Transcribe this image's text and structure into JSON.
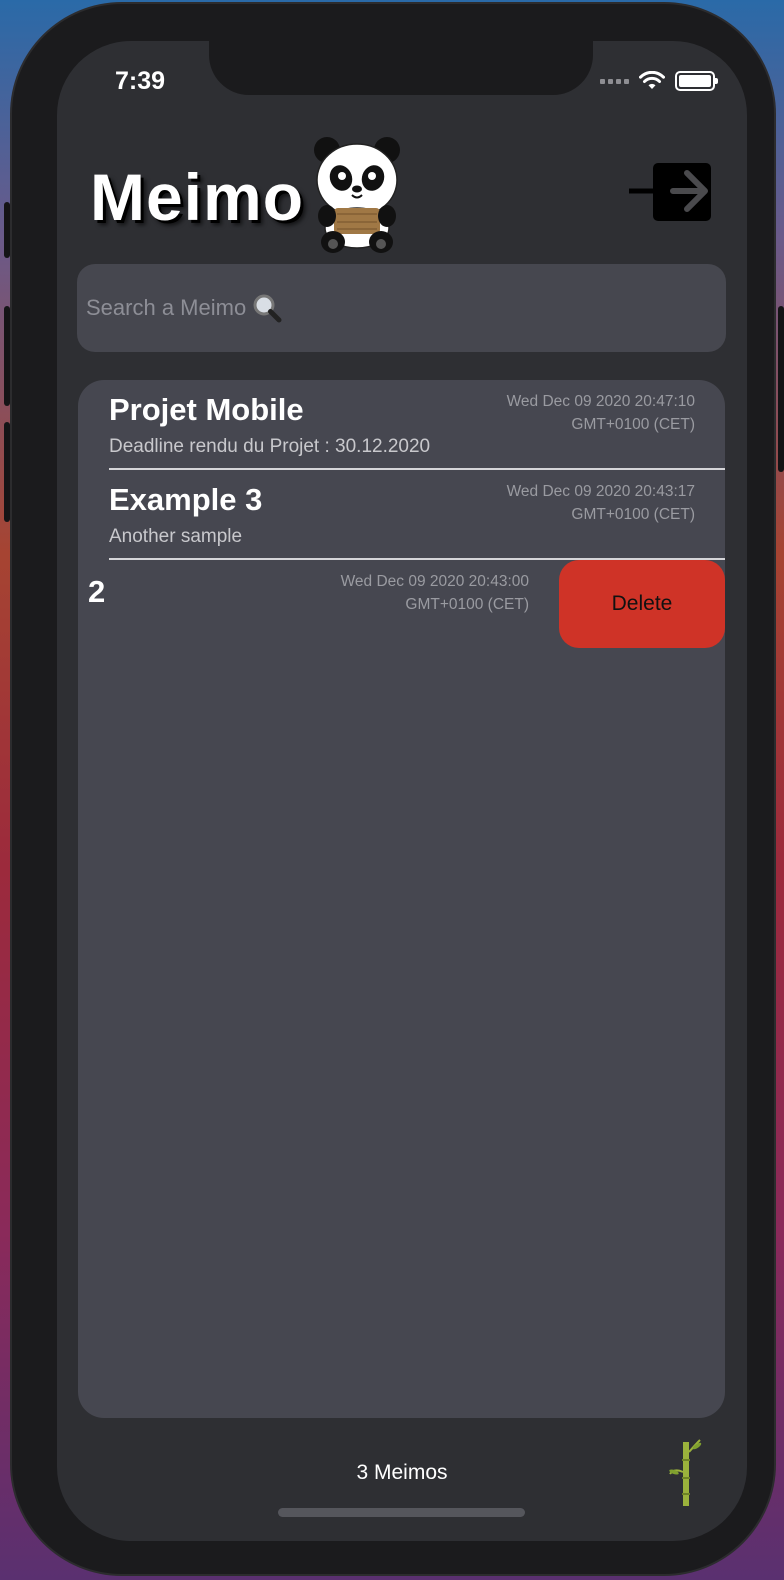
{
  "status_bar": {
    "time": "7:39"
  },
  "header": {
    "title": "Meimo",
    "panda_icon": "panda-icon",
    "logout_icon": "logout-arrow-icon"
  },
  "search": {
    "placeholder": "Search a Meimo",
    "icon": "magnifier-icon"
  },
  "memos": [
    {
      "title": "Projet Mobile",
      "subtitle": "Deadline rendu du Projet : 30.12.2020",
      "date_line1": "Wed Dec 09 2020 20:47:10",
      "date_line2": "GMT+0100 (CET)"
    },
    {
      "title": "Example 3",
      "subtitle": "Another sample",
      "date_line1": "Wed Dec 09 2020 20:43:17",
      "date_line2": "GMT+0100 (CET)"
    },
    {
      "title": "2",
      "subtitle": "",
      "date_line1": "Wed Dec 09 2020 20:43:00",
      "date_line2": "GMT+0100 (CET)",
      "swiped": true
    }
  ],
  "row_actions": {
    "delete_label": "Delete"
  },
  "footer": {
    "count_label": "3 Meimos",
    "icon": "bamboo-icon"
  },
  "colors": {
    "delete": "#cf3327",
    "background": "#2e2f33",
    "card": "#464750"
  }
}
